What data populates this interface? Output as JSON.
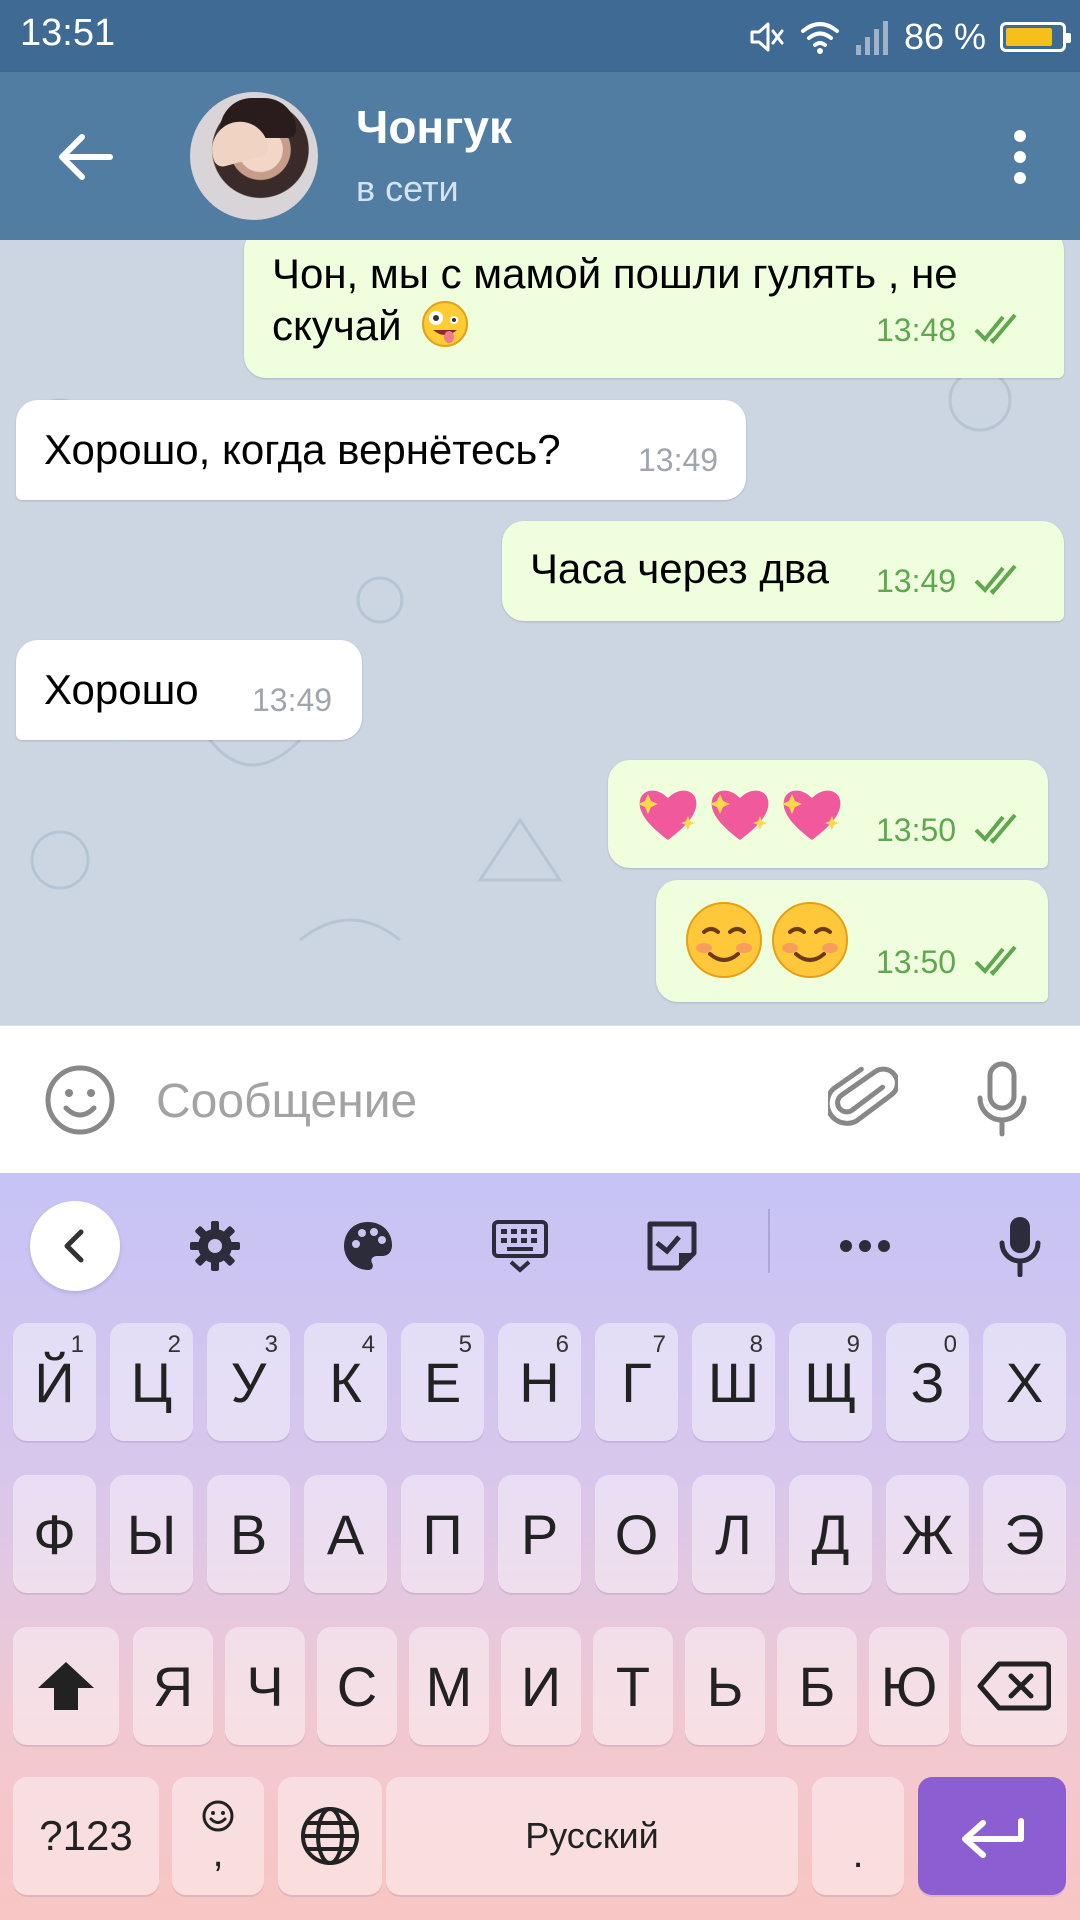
{
  "status_bar": {
    "time": "13:51",
    "battery_percent": "86 %",
    "battery_level": 0.86,
    "icons": [
      "mute-icon",
      "wifi-icon",
      "signal-icon",
      "battery-icon"
    ],
    "colors": {
      "bar": "#3f6a94",
      "battery_fill": "#f5c018"
    }
  },
  "header": {
    "contact_name": "Чонгук",
    "contact_status": "в сети",
    "icons": [
      "back-arrow-icon",
      "avatar",
      "more-vertical-icon"
    ],
    "colors": {
      "header": "#517da2"
    }
  },
  "messages": [
    {
      "direction": "out",
      "text_line1": "Чон, мы с мамой пошли гулять , не",
      "text_line2": "скучай",
      "emoji": "zany-face-emoji",
      "time": "13:48",
      "read": true
    },
    {
      "direction": "in",
      "text": "Хорошо, когда вернётесь?",
      "time": "13:49"
    },
    {
      "direction": "out",
      "text": "Часа через два",
      "time": "13:49",
      "read": true
    },
    {
      "direction": "in",
      "text": "Хорошо",
      "time": "13:49"
    },
    {
      "direction": "out",
      "emoji": "sparkling-heart-emoji x3",
      "time": "13:50",
      "read": true
    },
    {
      "direction": "out",
      "emoji": "smiling-face-emoji x2",
      "time": "13:50",
      "read": true
    }
  ],
  "composer": {
    "placeholder": "Сообщение",
    "icons": [
      "emoji-icon",
      "attach-icon",
      "microphone-icon"
    ]
  },
  "keyboard": {
    "toolbar_icons": [
      "chevron-left-icon",
      "settings-icon",
      "palette-icon",
      "keyboard-icon",
      "sticker-icon",
      "more-horizontal-icon",
      "microphone-icon"
    ],
    "row1": [
      {
        "label": "Й",
        "hint": "1"
      },
      {
        "label": "Ц",
        "hint": "2"
      },
      {
        "label": "У",
        "hint": "3"
      },
      {
        "label": "К",
        "hint": "4"
      },
      {
        "label": "Е",
        "hint": "5"
      },
      {
        "label": "Н",
        "hint": "6"
      },
      {
        "label": "Г",
        "hint": "7"
      },
      {
        "label": "Ш",
        "hint": "8"
      },
      {
        "label": "Щ",
        "hint": "9"
      },
      {
        "label": "З",
        "hint": "0"
      },
      {
        "label": "Х",
        "hint": ""
      }
    ],
    "row2": [
      "Ф",
      "Ы",
      "В",
      "А",
      "П",
      "Р",
      "О",
      "Л",
      "Д",
      "Ж",
      "Э"
    ],
    "row3": [
      "Я",
      "Ч",
      "С",
      "М",
      "И",
      "Т",
      "Ь",
      "Б",
      "Ю"
    ],
    "row4": {
      "symbols": "?123",
      "emoji_comma": ",",
      "space": "Русский",
      "period": "."
    },
    "colors": {
      "enter_key": "#8b5fd1"
    }
  }
}
